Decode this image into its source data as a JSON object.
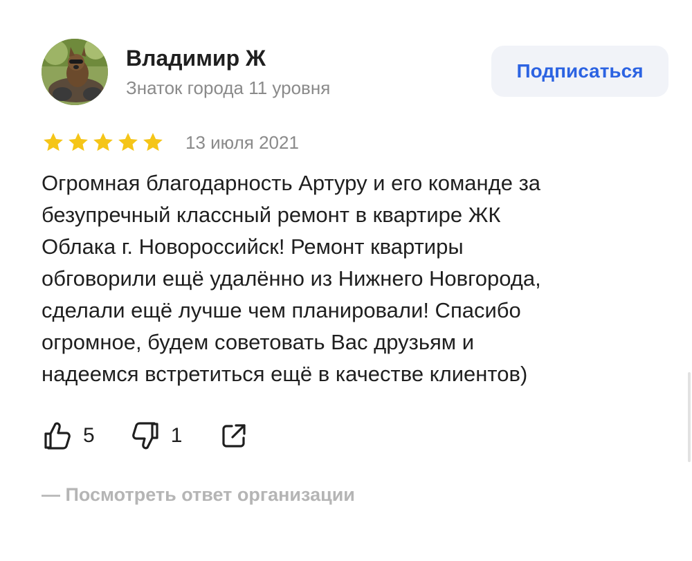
{
  "author": {
    "name": "Владимир Ж",
    "level": "Знаток города 11 уровня",
    "avatar_icon": "dog-on-motorcycle-photo"
  },
  "subscribe_label": "Подписаться",
  "review": {
    "rating": 5,
    "max_rating": 5,
    "date": "13 июля 2021",
    "text": "Огромная благодарность Артуру и его команде за\nбезупречный классный ремонт в квартире ЖК\nОблака г. Новороссийск! Ремонт квартиры\nобговорили ещё удалённо из Нижнего Новгорода,\nсделали ещё лучше чем планировали! Спасибо\nогромное, будем советовать Вас друзьям и\nнадеемся встретиться ещё в качестве клиентов)"
  },
  "actions": {
    "likes": "5",
    "dislikes": "1",
    "like_icon": "thumbs-up-icon",
    "dislike_icon": "thumbs-down-icon",
    "share_icon": "share-icon"
  },
  "org_response_label": "— Посмотреть ответ организации",
  "colors": {
    "star": "#f5c518",
    "link": "#2c63e2",
    "muted": "#8a8a8a",
    "button_bg": "#f1f3f8"
  }
}
